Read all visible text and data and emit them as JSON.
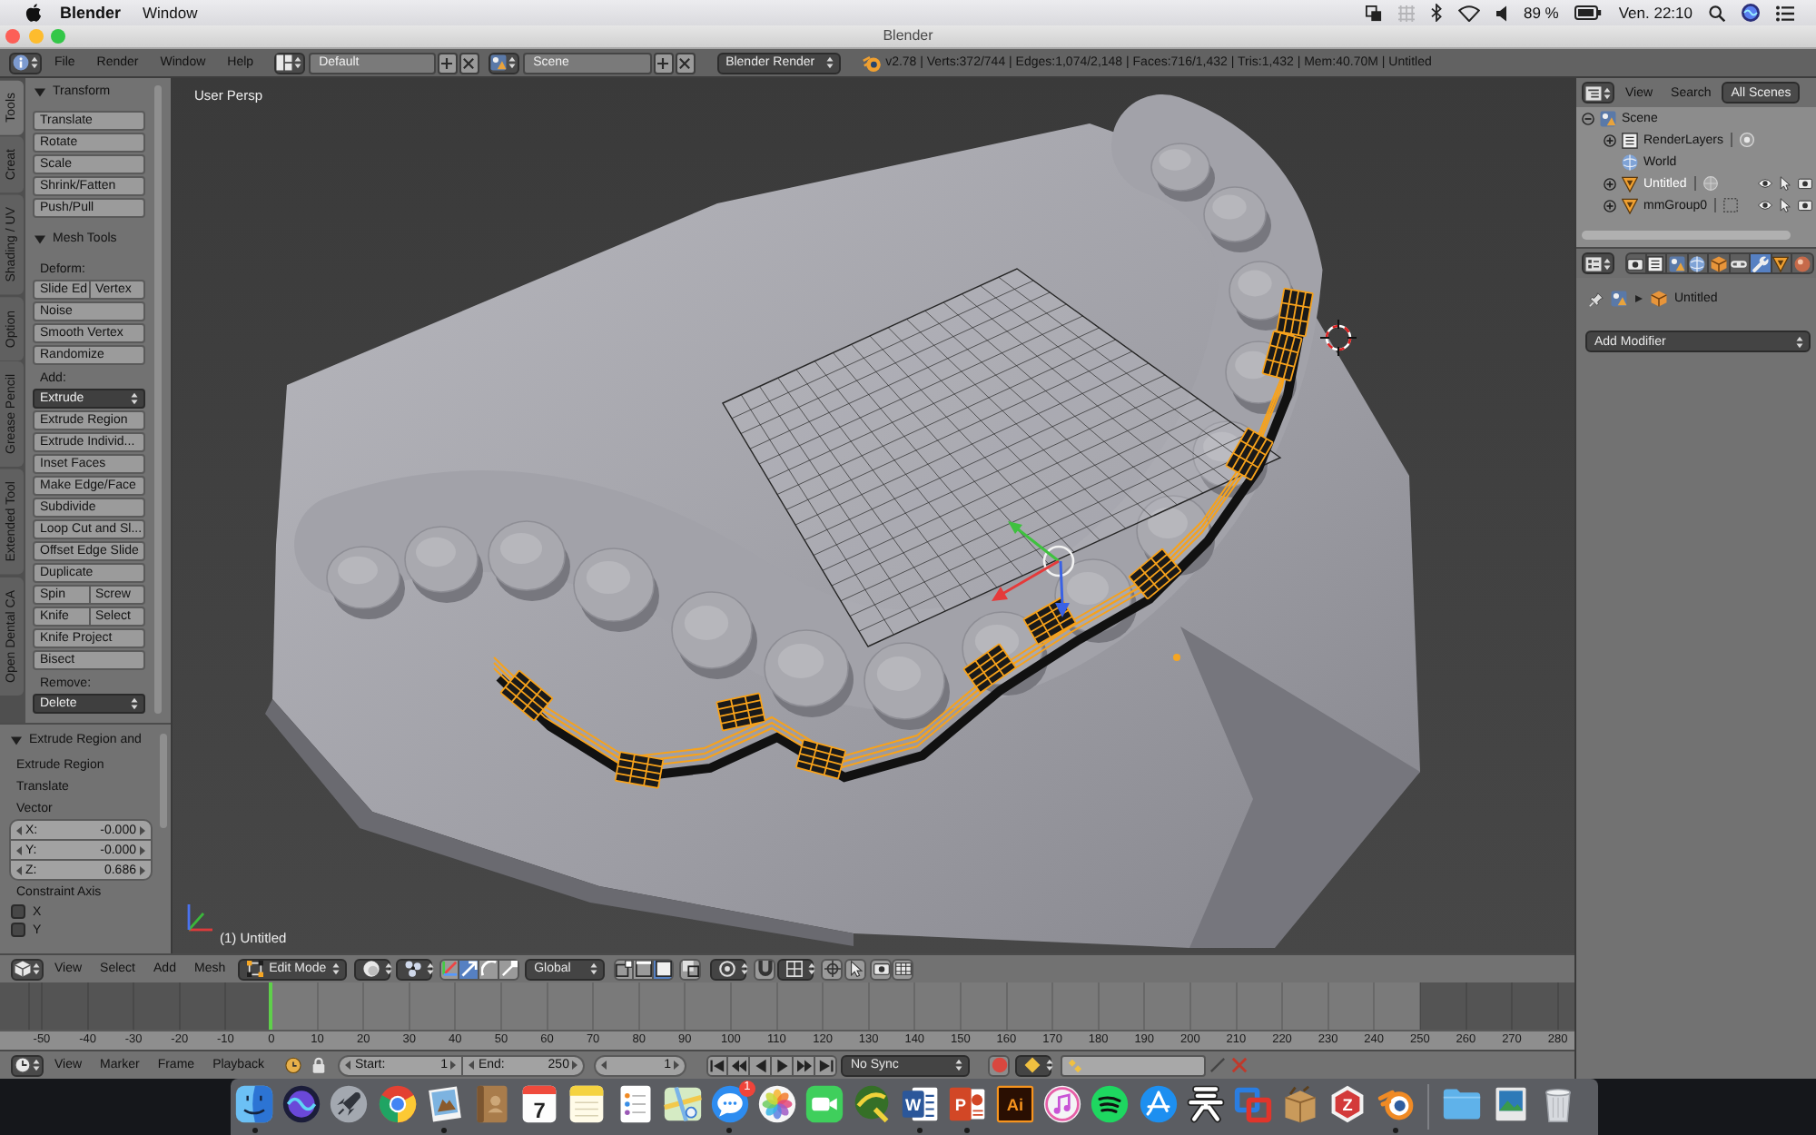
{
  "menu_bar": {
    "app_name": "Blender",
    "menus": [
      "Window"
    ],
    "battery": "89 %",
    "clock": "Ven. 22:10"
  },
  "window": {
    "title": "Blender"
  },
  "info_header": {
    "menus": [
      "File",
      "Render",
      "Window",
      "Help"
    ],
    "layout": "Default",
    "scene": "Scene",
    "render_engine": "Blender Render",
    "stats": "v2.78 | Verts:372/744 | Edges:1,074/2,148 | Faces:716/1,432 | Tris:1,432 | Mem:40.70M | Untitled"
  },
  "tool_tabs": [
    {
      "label": "Tools",
      "selected": true
    },
    {
      "label": "Creat",
      "selected": false
    },
    {
      "label": "Shading / UV",
      "selected": false
    },
    {
      "label": "Option",
      "selected": false
    },
    {
      "label": "Grease Pencil",
      "selected": false
    },
    {
      "label": "Extended Tool",
      "selected": false
    },
    {
      "label": "Open Dental CA",
      "selected": false
    }
  ],
  "tool_shelf": {
    "panels": [
      {
        "title": "Transform",
        "expanded": true,
        "rows": [
          {
            "kind": "buttons",
            "labels": [
              "Translate"
            ]
          },
          {
            "kind": "buttons",
            "labels": [
              "Rotate"
            ]
          },
          {
            "kind": "buttons",
            "labels": [
              "Scale"
            ]
          },
          {
            "kind": "buttons",
            "labels": [
              "Shrink/Fatten"
            ]
          },
          {
            "kind": "buttons",
            "labels": [
              "Push/Pull"
            ]
          }
        ]
      },
      {
        "title": "Mesh Tools",
        "expanded": true,
        "rows": [
          {
            "kind": "label",
            "text": "Deform:"
          },
          {
            "kind": "buttons",
            "labels": [
              "Slide Ed",
              "Vertex"
            ]
          },
          {
            "kind": "buttons",
            "labels": [
              "Noise"
            ]
          },
          {
            "kind": "buttons",
            "labels": [
              "Smooth Vertex"
            ]
          },
          {
            "kind": "buttons",
            "labels": [
              "Randomize"
            ]
          },
          {
            "kind": "label",
            "text": "Add:"
          },
          {
            "kind": "dropdown",
            "text": "Extrude"
          },
          {
            "kind": "buttons",
            "labels": [
              "Extrude Region"
            ]
          },
          {
            "kind": "buttons",
            "labels": [
              "Extrude Individ..."
            ]
          },
          {
            "kind": "buttons",
            "labels": [
              "Inset Faces"
            ]
          },
          {
            "kind": "buttons",
            "labels": [
              "Make Edge/Face"
            ]
          },
          {
            "kind": "buttons",
            "labels": [
              "Subdivide"
            ]
          },
          {
            "kind": "buttons",
            "labels": [
              "Loop Cut and Sl..."
            ]
          },
          {
            "kind": "buttons",
            "labels": [
              "Offset Edge Slide"
            ]
          },
          {
            "kind": "buttons",
            "labels": [
              "Duplicate"
            ]
          },
          {
            "kind": "buttons",
            "labels": [
              "Spin",
              "Screw"
            ]
          },
          {
            "kind": "buttons",
            "labels": [
              "Knife",
              "Select"
            ]
          },
          {
            "kind": "buttons",
            "labels": [
              "Knife Project"
            ]
          },
          {
            "kind": "buttons",
            "labels": [
              "Bisect"
            ]
          },
          {
            "kind": "label",
            "text": "Remove:"
          },
          {
            "kind": "dropdown",
            "text": "Delete"
          }
        ]
      }
    ]
  },
  "operator_panel": {
    "title": "Extrude Region and",
    "expanded": true,
    "rows": [
      {
        "kind": "label",
        "text": "Extrude Region"
      },
      {
        "kind": "label",
        "text": "Translate"
      },
      {
        "kind": "label",
        "text": "Vector"
      },
      {
        "kind": "number",
        "label": "X:",
        "value": "-0.000"
      },
      {
        "kind": "number",
        "label": "Y:",
        "value": "-0.000"
      },
      {
        "kind": "number",
        "label": "Z:",
        "value": "0.686"
      },
      {
        "kind": "label",
        "text": "Constraint Axis"
      },
      {
        "kind": "checkbox",
        "label": "X",
        "checked": false
      },
      {
        "kind": "checkbox",
        "label": "Y",
        "checked": false
      }
    ]
  },
  "viewport": {
    "view_name": "User Persp",
    "object_label": "(1) Untitled"
  },
  "viewport_header": {
    "menus": [
      "View",
      "Select",
      "Add",
      "Mesh"
    ],
    "mode": "Edit Mode",
    "manipulators": [
      {
        "kind": "toggle",
        "selected": false
      },
      {
        "kind": "translate",
        "selected": true
      },
      {
        "kind": "rotate",
        "selected": false
      },
      {
        "kind": "scale",
        "selected": false
      }
    ],
    "orientation": "Global",
    "select_modes": [
      {
        "kind": "vertex",
        "selected": false
      },
      {
        "kind": "edge",
        "selected": false
      },
      {
        "kind": "face",
        "selected": true
      }
    ]
  },
  "timeline": {
    "range_start": {
      "level": 0.171
    },
    "range_end": {
      "level": 0.902
    },
    "playhead": {
      "level": 0.172
    },
    "ruler_labels": [
      "-50",
      "-40",
      "-30",
      "-20",
      "-10",
      "0",
      "10",
      "20",
      "30",
      "40",
      "50",
      "60",
      "70",
      "80",
      "90",
      "100",
      "110",
      "120",
      "130",
      "140",
      "150",
      "160",
      "170",
      "180",
      "190",
      "200",
      "210",
      "220",
      "230",
      "240",
      "250",
      "260",
      "270",
      "280"
    ]
  },
  "timeline_header": {
    "menus": [
      "View",
      "Marker",
      "Frame",
      "Playback"
    ],
    "start_label": "Start:",
    "start": "1",
    "end_label": "End:",
    "end": "250",
    "current_frame": "1",
    "sync": "No Sync"
  },
  "outliner": {
    "menus": [
      "View",
      "Search"
    ],
    "filter": "All Scenes",
    "tree": [
      {
        "label": "Scene",
        "kind": "scene",
        "expanded": true,
        "selected": false,
        "children": [
          {
            "label": "RenderLayers",
            "kind": "render_layers",
            "expanded": false,
            "selected": false
          },
          {
            "label": "World",
            "kind": "world",
            "selected": false
          },
          {
            "label": "Untitled",
            "kind": "mesh",
            "expanded": false,
            "selected": true
          },
          {
            "label": "mmGroup0",
            "kind": "group",
            "expanded": false,
            "selected": false
          }
        ]
      }
    ]
  },
  "properties": {
    "tabs": [
      {
        "kind": "render",
        "selected": false
      },
      {
        "kind": "layers",
        "selected": false
      },
      {
        "kind": "scene",
        "selected": false
      },
      {
        "kind": "world",
        "selected": false
      },
      {
        "kind": "object",
        "selected": false
      },
      {
        "kind": "constraints",
        "selected": false
      },
      {
        "kind": "modifiers",
        "selected": true
      },
      {
        "kind": "data",
        "selected": false
      },
      {
        "kind": "material",
        "selected": false
      }
    ],
    "object_name": "Untitled",
    "add_button": "Add Modifier"
  },
  "dock": {
    "items": [
      {
        "kind": "face",
        "running": true
      },
      {
        "kind": "orb",
        "running": false
      },
      {
        "kind": "rocket",
        "running": false
      },
      {
        "kind": "ring",
        "running": false
      },
      {
        "kind": "stamp",
        "running": true
      },
      {
        "kind": "book",
        "running": false
      },
      {
        "kind": "calendar",
        "glyph": "7",
        "running": false
      },
      {
        "kind": "notepad",
        "running": false
      },
      {
        "kind": "list",
        "running": false
      },
      {
        "kind": "map",
        "running": false
      },
      {
        "kind": "chat",
        "badge": "1",
        "running": true
      },
      {
        "kind": "flower",
        "running": false
      },
      {
        "kind": "camera",
        "running": false
      },
      {
        "kind": "globe",
        "running": false
      },
      {
        "kind": "doc",
        "glyph": "W",
        "running": true
      },
      {
        "kind": "slides",
        "glyph": "P",
        "running": true
      },
      {
        "kind": "letter",
        "glyph": "Ai",
        "running": false
      },
      {
        "kind": "note",
        "running": false
      },
      {
        "kind": "waves",
        "running": false
      },
      {
        "kind": "store",
        "running": false
      },
      {
        "kind": "figure",
        "running": false
      },
      {
        "kind": "squares",
        "running": false
      },
      {
        "kind": "box",
        "running": false
      },
      {
        "kind": "hexagon",
        "glyph": "Z",
        "running": false
      },
      {
        "kind": "eye",
        "running": true
      },
      {
        "kind": "separator"
      },
      {
        "kind": "folder",
        "running": false
      },
      {
        "kind": "picture",
        "running": false
      },
      {
        "kind": "trash",
        "running": false
      }
    ]
  }
}
